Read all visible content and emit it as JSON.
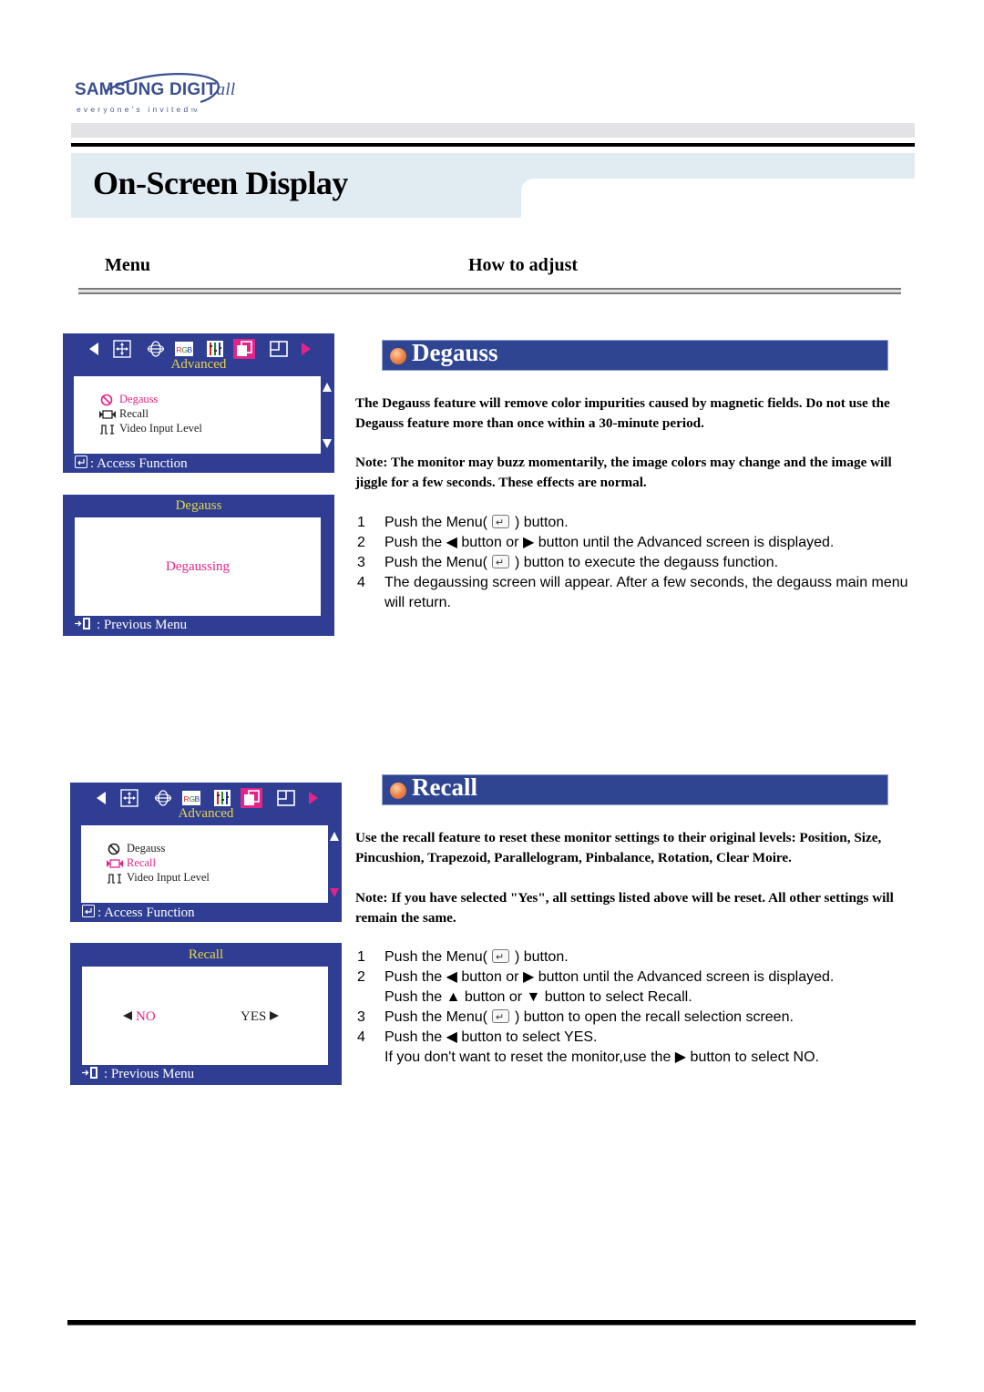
{
  "brand": {
    "logo_main": "SAMSUNG DIGIT",
    "logo_script": "all",
    "tagline": "everyone's invited",
    "tagline_tm": "TM"
  },
  "page_title": "On-Screen Display",
  "columns": {
    "menu": "Menu",
    "how_to_adjust": "How to adjust"
  },
  "colors": {
    "osd_background": "#2f3d92",
    "osd_title": "#e8d64a",
    "osd_selected": "#e2248a",
    "section_bar": "#2f4592",
    "title_band": "#e1ebf2"
  },
  "osd_tab_icons": [
    "left-arrow-icon",
    "position-icon",
    "geometry-icon",
    "rgb-icon",
    "color-bars-icon",
    "advanced-icon",
    "window-icon",
    "right-arrow-icon"
  ],
  "sections": [
    {
      "id": "degauss",
      "title": "Degauss",
      "osd_menu": {
        "title": "Advanced",
        "items": [
          {
            "label": "Degauss",
            "icon": "degauss-icon",
            "selected": true
          },
          {
            "label": "Recall",
            "icon": "recall-icon",
            "selected": false
          },
          {
            "label": "Video Input Level",
            "icon": "video-level-icon",
            "selected": false
          }
        ],
        "footer": ": Access Function"
      },
      "osd_dialog": {
        "title": "Degauss",
        "message": "Degaussing",
        "footer": ": Previous Menu"
      },
      "paragraphs": [
        "The Degauss feature will remove color impurities caused by magnetic fields. Do not use the Degauss feature more than once within a 30-minute period.",
        "Note: The monitor may buzz momentarily, the image colors may change and the image will jiggle for a few seconds. These effects are normal."
      ],
      "steps": [
        {
          "num": "1",
          "before": "Push the Menu(",
          "after": ") button."
        },
        {
          "num": "2",
          "text": "Push the ◀ button or ▶ button until the Advanced screen is displayed."
        },
        {
          "num": "3",
          "before": "Push the Menu(",
          "after": ") button to execute the degauss function."
        },
        {
          "num": "4",
          "text": "The degaussing screen will appear. After a few seconds, the degauss main menu will return."
        }
      ]
    },
    {
      "id": "recall",
      "title": "Recall",
      "osd_menu": {
        "title": "Advanced",
        "items": [
          {
            "label": "Degauss",
            "icon": "degauss-icon",
            "selected": false
          },
          {
            "label": "Recall",
            "icon": "recall-icon",
            "selected": true
          },
          {
            "label": "Video Input Level",
            "icon": "video-level-icon",
            "selected": false
          }
        ],
        "footer": ": Access Function"
      },
      "osd_dialog": {
        "title": "Recall",
        "option_no": "NO",
        "option_yes": "YES",
        "selected": "NO",
        "footer": ": Previous Menu"
      },
      "paragraphs": [
        "Use the recall feature to reset these monitor settings to their original levels: Position, Size, Pincushion, Trapezoid, Parallelogram, Pinbalance, Rotation, Clear Moire.",
        "Note: If you have selected \"Yes\", all settings listed above will be reset. All other settings will remain the same."
      ],
      "steps": [
        {
          "num": "1",
          "before": "Push the Menu(",
          "after": ") button."
        },
        {
          "num": "2",
          "text": "Push the ◀ button or ▶ button until the Advanced screen is displayed."
        },
        {
          "num": "",
          "text": "Push the ▲ button or ▼ button to select Recall."
        },
        {
          "num": "3",
          "before": "Push the Menu(",
          "after": ") button to open the recall selection screen."
        },
        {
          "num": "4",
          "text": "Push the ◀ button to select YES."
        },
        {
          "num": "",
          "text": "If you don't want to reset the monitor,use the ▶ button to select NO."
        }
      ]
    }
  ]
}
